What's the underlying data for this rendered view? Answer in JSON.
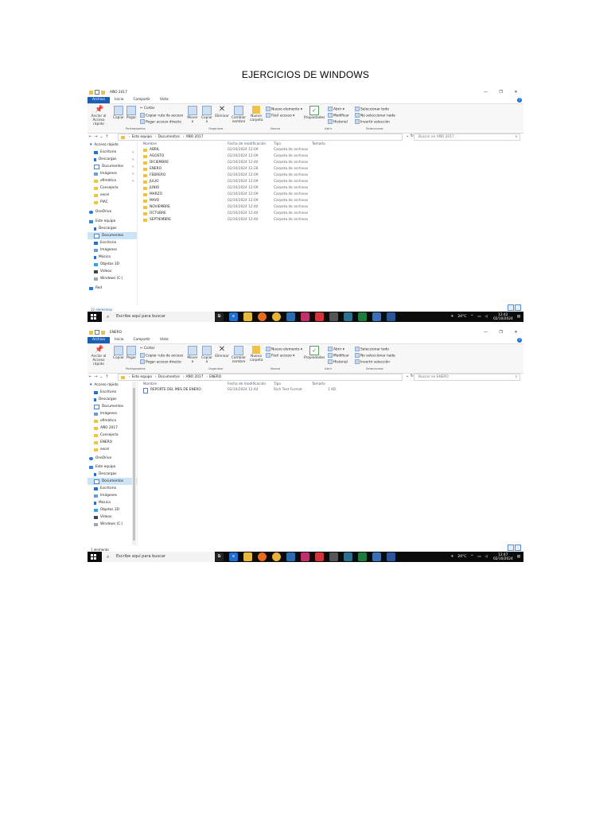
{
  "document": {
    "title": "EJERCICIOS DE WINDOWS"
  },
  "screenshot1": {
    "window_title": "AÑO 2017",
    "tabs": [
      "Archivo",
      "Inicio",
      "Compartir",
      "Vista"
    ],
    "ribbon": {
      "anclar": "Anclar al Acceso rápido",
      "copiar": "Copiar",
      "pegar": "Pegar",
      "cortar": "Cortar",
      "copiar_ruta": "Copiar ruta de acceso",
      "pegar_acceso": "Pegar acceso directo",
      "mover": "Mover a",
      "copiar_a": "Copiar a",
      "eliminar": "Eliminar",
      "cambiar_nombre": "Cambiar nombre",
      "nueva_carpeta": "Nueva carpeta",
      "nuevo_elemento": "Nuevo elemento",
      "facil_acceso": "Fácil acceso",
      "propiedades": "Propiedades",
      "abrir": "Abrir",
      "modificar": "Modificar",
      "historial": "Historial",
      "seleccionar_todo": "Seleccionar todo",
      "no_seleccionar": "No seleccionar nada",
      "invertir": "Invertir selección",
      "groups": [
        "Portapapeles",
        "Organizar",
        "Nuevo",
        "Abrir",
        "Seleccionar"
      ]
    },
    "breadcrumb": [
      "Este equipo",
      "Documentos",
      "AÑO 2017"
    ],
    "search_placeholder": "Buscar en AÑO 2017",
    "nav": [
      {
        "label": "Acceso rápido",
        "icon": "star-icon"
      },
      {
        "label": "Escritorio",
        "icon": "desktop-icon"
      },
      {
        "label": "Descargas",
        "icon": "download-icon"
      },
      {
        "label": "Documentos",
        "icon": "documents-icon"
      },
      {
        "label": "Imágenes",
        "icon": "pictures-icon"
      },
      {
        "label": "ofimática",
        "icon": "folder-icon"
      },
      {
        "label": "Consejería",
        "icon": "folder-icon"
      },
      {
        "label": "excel",
        "icon": "folder-icon"
      },
      {
        "label": "PIAC",
        "icon": "folder-icon"
      },
      {
        "label": "OneDrive",
        "icon": "cloud-icon"
      },
      {
        "label": "Este equipo",
        "icon": "computer-icon"
      },
      {
        "label": "Descargas",
        "icon": "download-icon"
      },
      {
        "label": "Documentos",
        "icon": "documents-icon"
      },
      {
        "label": "Escritorio",
        "icon": "desktop-icon"
      },
      {
        "label": "Imágenes",
        "icon": "pictures-icon"
      },
      {
        "label": "Música",
        "icon": "music-icon"
      },
      {
        "label": "Objetos 3D",
        "icon": "cube-icon"
      },
      {
        "label": "Videos",
        "icon": "video-icon"
      },
      {
        "label": "Windows (C:)",
        "icon": "drive-icon"
      },
      {
        "label": "Red",
        "icon": "network-icon"
      }
    ],
    "columns": [
      "Nombre",
      "Fecha de modificación",
      "Tipo",
      "Tamaño"
    ],
    "files": [
      {
        "name": "ABRIL",
        "date": "02/10/2024 12:09",
        "type": "Carpeta de archivos",
        "size": ""
      },
      {
        "name": "AGOSTO",
        "date": "02/10/2024 12:09",
        "type": "Carpeta de archivos",
        "size": ""
      },
      {
        "name": "DICIEMBRE",
        "date": "02/10/2024 12:40",
        "type": "Carpeta de archivos",
        "size": ""
      },
      {
        "name": "ENERO",
        "date": "02/10/2024 12:28",
        "type": "Carpeta de archivos",
        "size": ""
      },
      {
        "name": "FEBRERO",
        "date": "02/10/2024 12:09",
        "type": "Carpeta de archivos",
        "size": ""
      },
      {
        "name": "JULIO",
        "date": "02/10/2024 12:09",
        "type": "Carpeta de archivos",
        "size": ""
      },
      {
        "name": "JUNIO",
        "date": "02/10/2024 12:09",
        "type": "Carpeta de archivos",
        "size": ""
      },
      {
        "name": "MARZO",
        "date": "02/10/2024 12:09",
        "type": "Carpeta de archivos",
        "size": ""
      },
      {
        "name": "MAYO",
        "date": "02/10/2024 12:09",
        "type": "Carpeta de archivos",
        "size": ""
      },
      {
        "name": "NOVIEMBRE",
        "date": "02/10/2024 12:40",
        "type": "Carpeta de archivos",
        "size": ""
      },
      {
        "name": "OCTUBRE",
        "date": "02/10/2024 12:40",
        "type": "Carpeta de archivos",
        "size": ""
      },
      {
        "name": "SEPTIEMBRE",
        "date": "02/10/2024 12:40",
        "type": "Carpeta de archivos",
        "size": ""
      }
    ],
    "status": "12 elementos",
    "taskbar": {
      "search": "Escribe aquí para buscar",
      "temp": "24°C",
      "time": "12:42",
      "date": "02/10/2024"
    }
  },
  "screenshot2": {
    "window_title": "ENERO",
    "tabs": [
      "Archivo",
      "Inicio",
      "Compartir",
      "Vista"
    ],
    "ribbon": {
      "anclar": "Anclar al Acceso rápido",
      "copiar": "Copiar",
      "pegar": "Pegar",
      "cortar": "Cortar",
      "copiar_ruta": "Copiar ruta de acceso",
      "pegar_acceso": "Pegar acceso directo",
      "mover": "Mover a",
      "copiar_a": "Copiar a",
      "eliminar": "Eliminar",
      "cambiar_nombre": "Cambiar nombre",
      "nueva_carpeta": "Nueva carpeta",
      "nuevo_elemento": "Nuevo elemento",
      "facil_acceso": "Fácil acceso",
      "propiedades": "Propiedades",
      "abrir": "Abrir",
      "modificar": "Modificar",
      "historial": "Historial",
      "seleccionar_todo": "Seleccionar todo",
      "no_seleccionar": "No seleccionar nada",
      "invertir": "Invertir selección",
      "groups": [
        "Portapapeles",
        "Organizar",
        "Nuevo",
        "Abrir",
        "Seleccionar"
      ]
    },
    "breadcrumb": [
      "Este equipo",
      "Documentos",
      "AÑO 2017",
      "ENERO"
    ],
    "search_placeholder": "Buscar en ENERO",
    "nav": [
      {
        "label": "Acceso rápido",
        "icon": "star-icon"
      },
      {
        "label": "Escritorio",
        "icon": "desktop-icon"
      },
      {
        "label": "Descargas",
        "icon": "download-icon"
      },
      {
        "label": "Documentos",
        "icon": "documents-icon"
      },
      {
        "label": "Imágenes",
        "icon": "pictures-icon"
      },
      {
        "label": "ofimática",
        "icon": "folder-icon"
      },
      {
        "label": "AÑO 2017",
        "icon": "folder-icon"
      },
      {
        "label": "Consejería",
        "icon": "folder-icon"
      },
      {
        "label": "ENERO",
        "icon": "folder-icon"
      },
      {
        "label": "excel",
        "icon": "folder-icon"
      },
      {
        "label": "OneDrive",
        "icon": "cloud-icon"
      },
      {
        "label": "Este equipo",
        "icon": "computer-icon"
      },
      {
        "label": "Descargas",
        "icon": "download-icon"
      },
      {
        "label": "Documentos",
        "icon": "documents-icon"
      },
      {
        "label": "Escritorio",
        "icon": "desktop-icon"
      },
      {
        "label": "Imágenes",
        "icon": "pictures-icon"
      },
      {
        "label": "Música",
        "icon": "music-icon"
      },
      {
        "label": "Objetos 3D",
        "icon": "cube-icon"
      },
      {
        "label": "Videos",
        "icon": "video-icon"
      },
      {
        "label": "Windows (C:)",
        "icon": "drive-icon"
      }
    ],
    "columns": [
      "Nombre",
      "Fecha de modificación",
      "Tipo",
      "Tamaño"
    ],
    "files": [
      {
        "name": "REPORTE DEL MES DE ENERO",
        "date": "02/10/2024 12:44",
        "type": "Rich Text Format",
        "size": "1 KB"
      }
    ],
    "status": "1 elemento",
    "taskbar": {
      "search": "Escribe aquí para buscar",
      "temp": "24°C",
      "time": "12:47",
      "date": "02/10/2024"
    }
  }
}
